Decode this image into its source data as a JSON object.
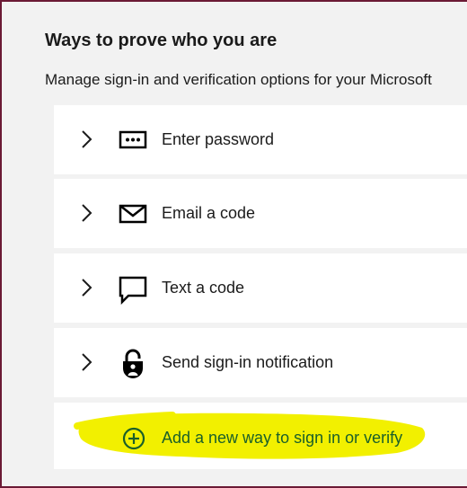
{
  "page": {
    "title": "Ways to prove who you are",
    "subtitle": "Manage sign-in and verification options for your Microsoft"
  },
  "methods": [
    {
      "label": "Enter password",
      "icon": "password-icon"
    },
    {
      "label": "Email a code",
      "icon": "envelope-icon"
    },
    {
      "label": "Text a code",
      "icon": "chat-bubble-icon"
    },
    {
      "label": "Send sign-in notification",
      "icon": "lock-icon"
    }
  ],
  "add_method": {
    "label": "Add a new way to sign in or verify",
    "icon": "plus-circle-icon",
    "highlight_color": "#f2f000",
    "text_color": "#1a5f2a"
  },
  "colors": {
    "border": "#6b1a35",
    "background": "#f2f2f2",
    "card": "#ffffff"
  }
}
